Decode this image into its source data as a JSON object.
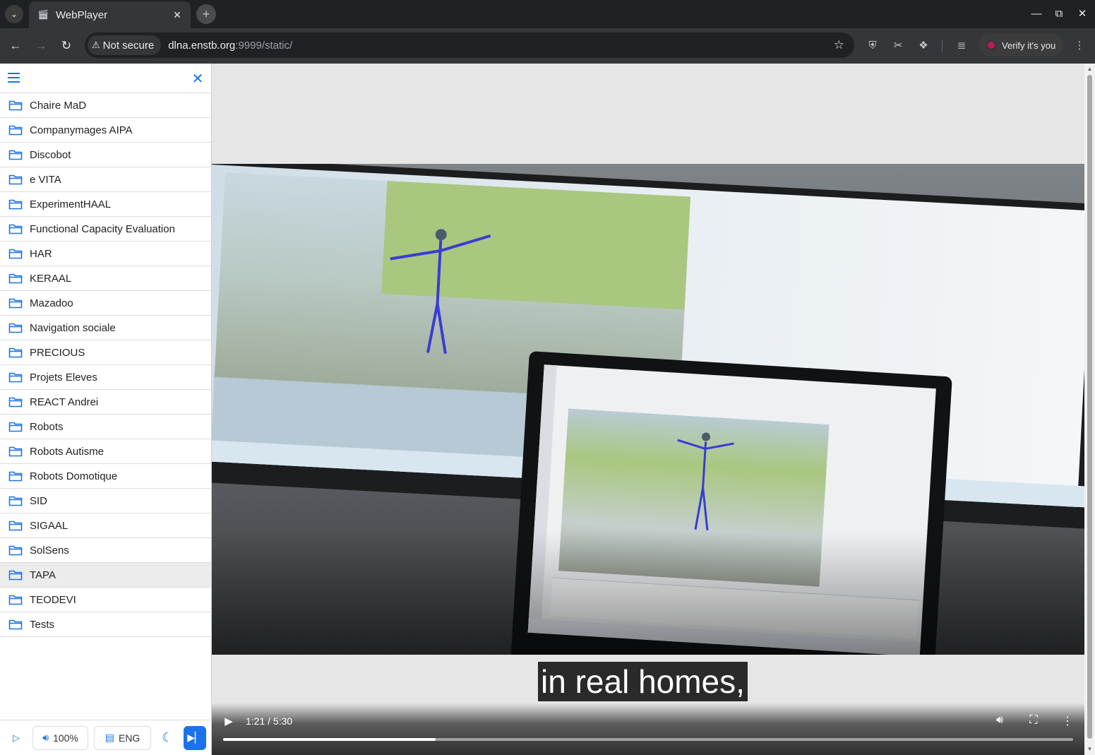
{
  "browser": {
    "tab_title": "WebPlayer",
    "security_label": "Not secure",
    "url_host": "dlna.enstb.org",
    "url_rest": ":9999/static/",
    "verify_label": "Verify it's you"
  },
  "sidebar": {
    "folders": [
      {
        "label": "Chaire MaD"
      },
      {
        "label": "Companymages AIPA"
      },
      {
        "label": "Discobot"
      },
      {
        "label": "e VITA"
      },
      {
        "label": "ExperimentHAAL"
      },
      {
        "label": "Functional Capacity Evaluation"
      },
      {
        "label": "HAR"
      },
      {
        "label": "KERAAL"
      },
      {
        "label": "Mazadoo"
      },
      {
        "label": "Navigation sociale"
      },
      {
        "label": "PRECIOUS"
      },
      {
        "label": "Projets Eleves"
      },
      {
        "label": "REACT Andrei"
      },
      {
        "label": "Robots"
      },
      {
        "label": "Robots Autisme"
      },
      {
        "label": "Robots Domotique"
      },
      {
        "label": "SID"
      },
      {
        "label": "SIGAAL"
      },
      {
        "label": "SolSens"
      },
      {
        "label": "TAPA"
      },
      {
        "label": "TEODEVI"
      },
      {
        "label": "Tests"
      }
    ],
    "selected_folder": "TAPA",
    "footer": {
      "volume_label": "100%",
      "subtitle_label": "ENG"
    }
  },
  "player": {
    "caption": "in real homes,",
    "time_display": "1:21 / 5:30",
    "progress": 0.25
  },
  "colors": {
    "accent": "#1a73e8",
    "browser_dark": "#202124",
    "browser_toolbar": "#35363a"
  }
}
